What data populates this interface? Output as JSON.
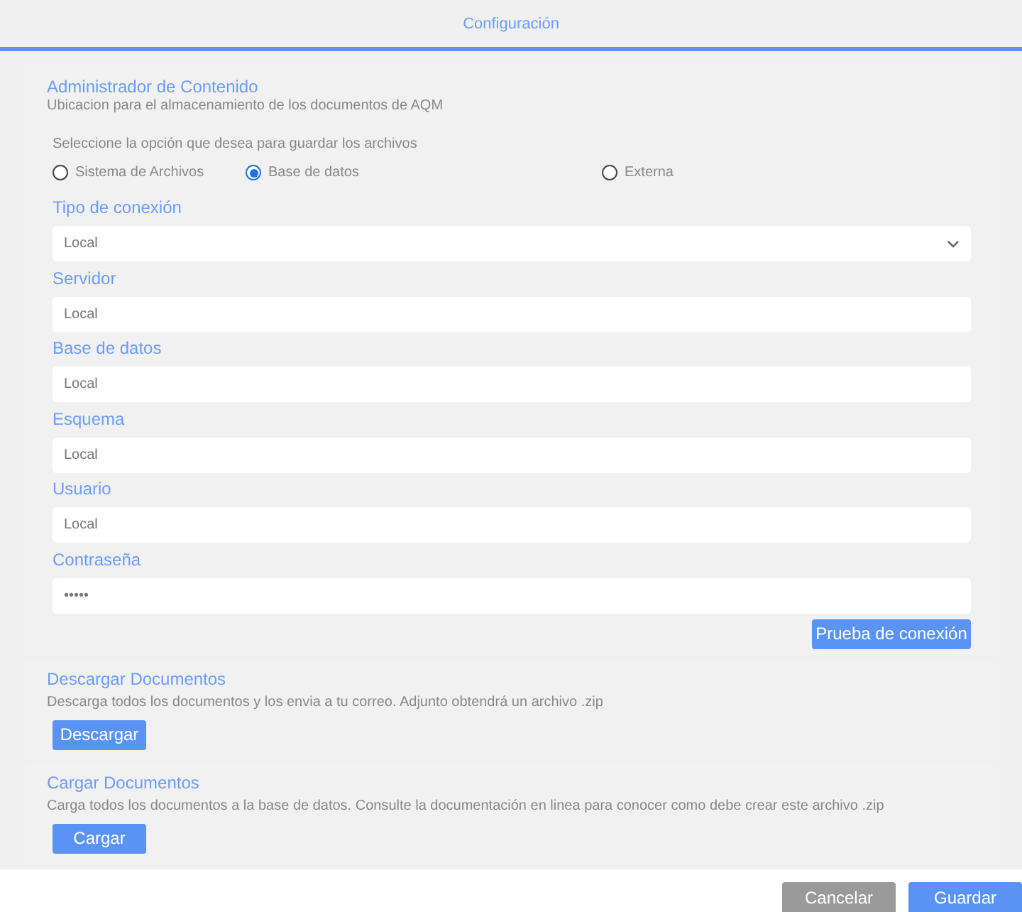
{
  "window": {
    "title": "Configuración"
  },
  "content_manager": {
    "title": "Administrador de Contenido",
    "subtitle": "Ubicacion para el almacenamiento de los documentos de AQM",
    "prompt": "Seleccione la opción que desea para guardar los archivos",
    "options": [
      {
        "label": "Sistema de Archivos",
        "selected": false
      },
      {
        "label": "Base de datos",
        "selected": true
      },
      {
        "label": "Externa",
        "selected": false
      }
    ],
    "fields": [
      {
        "label": "Tipo de conexión",
        "kind": "select",
        "value": "Local"
      },
      {
        "label": "Servidor",
        "kind": "text",
        "value": "Local"
      },
      {
        "label": "Base de datos",
        "kind": "text",
        "value": "Local"
      },
      {
        "label": "Esquema",
        "kind": "text",
        "value": "Local"
      },
      {
        "label": "Usuario",
        "kind": "text",
        "value": "Local"
      },
      {
        "label": "Contraseña",
        "kind": "text",
        "value": "•••••"
      }
    ],
    "test_button": "Prueba de conexión"
  },
  "sections": [
    {
      "title": "Descargar Documentos",
      "description": "Descarga todos los documentos y los envia a tu correo. Adjunto obtendrá un archivo .zip",
      "button": "Descargar"
    },
    {
      "title": "Cargar Documentos",
      "description": "Carga todos los documentos a la base de datos. Consulte la documentación en linea para conocer como debe crear este archivo .zip",
      "button": "Cargar"
    }
  ],
  "footer": {
    "buttons": [
      {
        "label": "Cancelar",
        "kind": "secondary"
      },
      {
        "label": "Guardar",
        "kind": "primary"
      }
    ]
  }
}
